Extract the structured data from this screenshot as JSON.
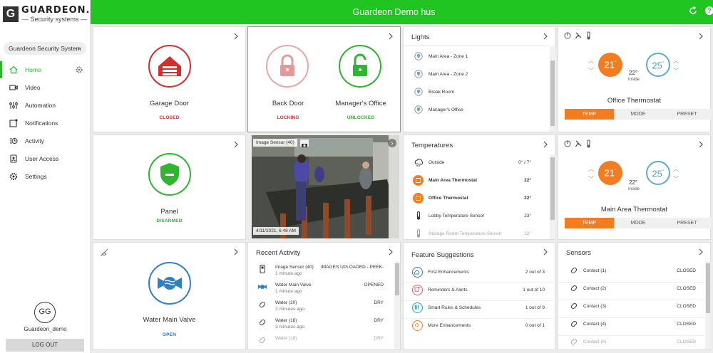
{
  "app": {
    "logo_mark": "G",
    "logo_name": "GUARDEON.dk",
    "logo_sub": "— Security systems —",
    "title": "Guardeon Demo hus"
  },
  "sidebar": {
    "account": "Guardeon Security System",
    "items": [
      {
        "label": "Home"
      },
      {
        "label": "Video"
      },
      {
        "label": "Automation"
      },
      {
        "label": "Notifications"
      },
      {
        "label": "Activity"
      },
      {
        "label": "User Access"
      },
      {
        "label": "Settings"
      }
    ],
    "avatar_initials": "GG",
    "username": "Guardeon_demo",
    "logout": "LOG OUT"
  },
  "garage": {
    "label": "Garage Door",
    "status": "CLOSED"
  },
  "backdoor": {
    "label": "Back Door",
    "status": "LOCKING"
  },
  "office": {
    "label": "Manager's Office",
    "status": "UNLOCKED"
  },
  "lights": {
    "title": "Lights",
    "items": [
      "Main Area - Zone 1",
      "Main Area - Zone 2",
      "Break Room",
      "Manager's Office"
    ]
  },
  "thermo1": {
    "setpoint": "21",
    "setpoint2": "25",
    "inside": "22°",
    "inside_label": "Inside",
    "name": "Office Thermostat"
  },
  "thermo2": {
    "setpoint": "21",
    "setpoint2": "25",
    "inside": "22°",
    "inside_label": "Inside",
    "name": "Main Area Thermostat"
  },
  "tabs": {
    "temp": "TEMP",
    "mode": "MODE",
    "preset": "PRESET"
  },
  "panel": {
    "label": "Panel",
    "status": "DISARMED"
  },
  "camera": {
    "label": "Image Sensor (40)",
    "timestamp": "4/11/2021, 6:48 AM"
  },
  "temperatures": {
    "title": "Temperatures",
    "rows": [
      {
        "name": "Outside",
        "value": "0° / 7°"
      },
      {
        "name": "Main Area Thermostat",
        "value": "22°"
      },
      {
        "name": "Office Thermostat",
        "value": "22°"
      },
      {
        "name": "Lobby Temperature Sensor",
        "value": "23°"
      },
      {
        "name": "Storage Room Temperature Sensor",
        "value": "22°"
      }
    ]
  },
  "water": {
    "label": "Water Main Valve",
    "status": "OPEN"
  },
  "activity": {
    "title": "Recent Activity",
    "rows": [
      {
        "name": "Image Sensor (40)",
        "time": "1 minute ago",
        "status": "IMAGES UPLOADED - PEEK-IN..."
      },
      {
        "name": "Water Main Valve",
        "time": "1 minute ago",
        "status": "OPENED"
      },
      {
        "name": "Water (20)",
        "time": "3 minutes ago",
        "status": "DRY"
      },
      {
        "name": "Water (18)",
        "time": "3 minutes ago",
        "status": "DRY"
      },
      {
        "name": "Water (18)",
        "time": "",
        "status": "DRY"
      }
    ]
  },
  "features": {
    "title": "Feature Suggestions",
    "rows": [
      {
        "name": "First Enhancements",
        "value": "2 out of 3"
      },
      {
        "name": "Reminders & Alerts",
        "value": "1 out of 10"
      },
      {
        "name": "Smart Rules & Schedules",
        "value": "1 out of 9"
      },
      {
        "name": "More Enhancements",
        "value": "0 out of 1"
      }
    ]
  },
  "sensors": {
    "title": "Sensors",
    "rows": [
      {
        "name": "Contact (1)",
        "status": "CLOSED"
      },
      {
        "name": "Contact (2)",
        "status": "CLOSED"
      },
      {
        "name": "Contact (3)",
        "status": "CLOSED"
      },
      {
        "name": "Contact (4)",
        "status": "CLOSED"
      },
      {
        "name": "Contact (6)",
        "status": "CLOSED"
      }
    ]
  },
  "colors": {
    "brand_green": "#21c521",
    "red": "#d32f2f",
    "orange": "#f47c20",
    "blue": "#2f7fc6"
  }
}
